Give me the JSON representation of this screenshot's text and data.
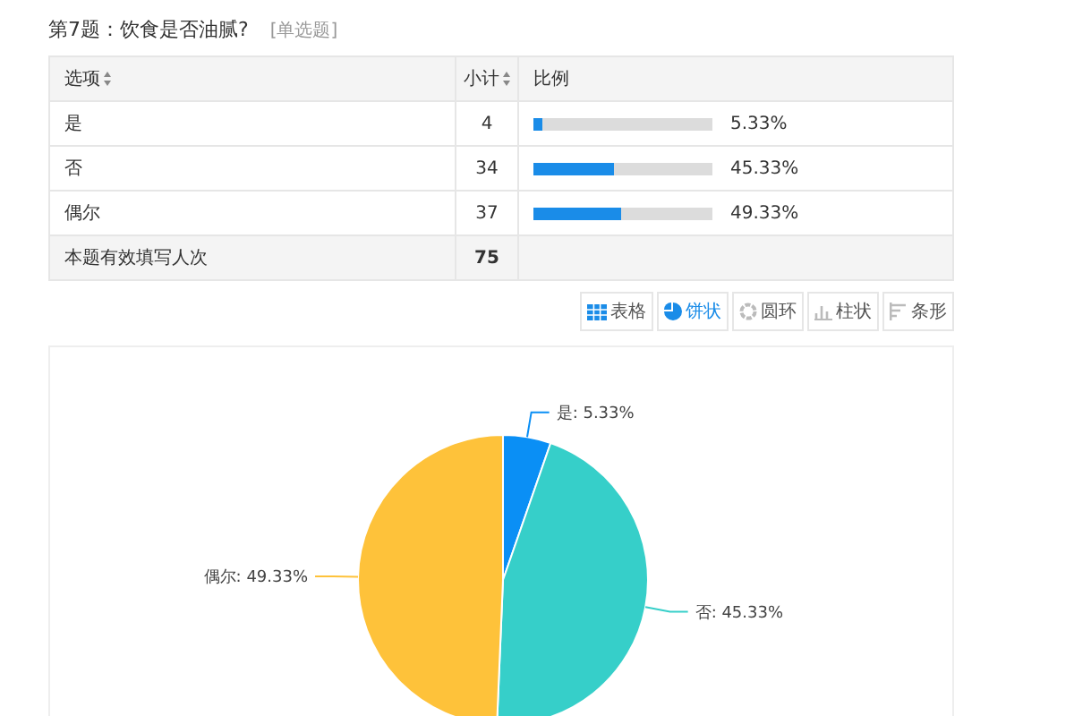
{
  "question": {
    "title": "第7题：饮食是否油腻?",
    "type_tag": "[单选题]"
  },
  "table": {
    "columns": [
      "选项",
      "小计",
      "比例"
    ],
    "rows": [
      {
        "option": "是",
        "count": "4",
        "level": 0.0533,
        "percent": "5.33%"
      },
      {
        "option": "否",
        "count": "34",
        "level": 0.4533,
        "percent": "45.33%"
      },
      {
        "option": "偶尔",
        "count": "37",
        "level": 0.4933,
        "percent": "49.33%"
      }
    ],
    "total": {
      "label": "本题有效填写人次",
      "count": "75"
    }
  },
  "chart_types": [
    {
      "kind": "table",
      "label": "表格",
      "selected": false
    },
    {
      "kind": "pie",
      "label": "饼状",
      "selected": true
    },
    {
      "kind": "ring",
      "label": "圆环",
      "selected": false
    },
    {
      "kind": "column",
      "label": "柱状",
      "selected": false
    },
    {
      "kind": "bar",
      "label": "条形",
      "selected": false
    }
  ],
  "chart": {
    "chart_data": {
      "type": "pie",
      "categories": [
        "是",
        "否",
        "偶尔"
      ],
      "values": [
        5.33,
        45.33,
        49.33
      ],
      "colors": [
        "#0a8ff5",
        "#36cfc9",
        "#fec23a"
      ],
      "value_labels": [
        ": 5.33%",
        ": 45.33%",
        ": 49.33%"
      ]
    }
  }
}
